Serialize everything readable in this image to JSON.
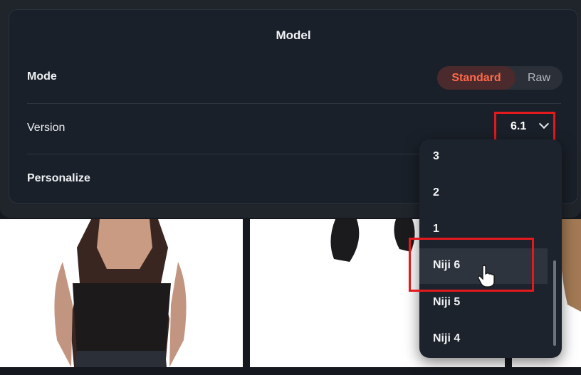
{
  "panel": {
    "title": "Model",
    "mode": {
      "label": "Mode",
      "options": [
        "Standard",
        "Raw"
      ],
      "selected": "Standard"
    },
    "version": {
      "label": "Version",
      "value": "6.1"
    },
    "personalize": {
      "label": "Personalize"
    }
  },
  "version_menu": {
    "items": [
      "3",
      "2",
      "1",
      "Niji 6",
      "Niji 5",
      "Niji 4"
    ],
    "hovered": "Niji 6"
  },
  "colors": {
    "accent": "#ff6a4b",
    "highlight_box": "#e3191d",
    "panel_bg": "#1a2029"
  },
  "icons": [
    "chevron-down-icon",
    "hand-pointer-icon"
  ]
}
